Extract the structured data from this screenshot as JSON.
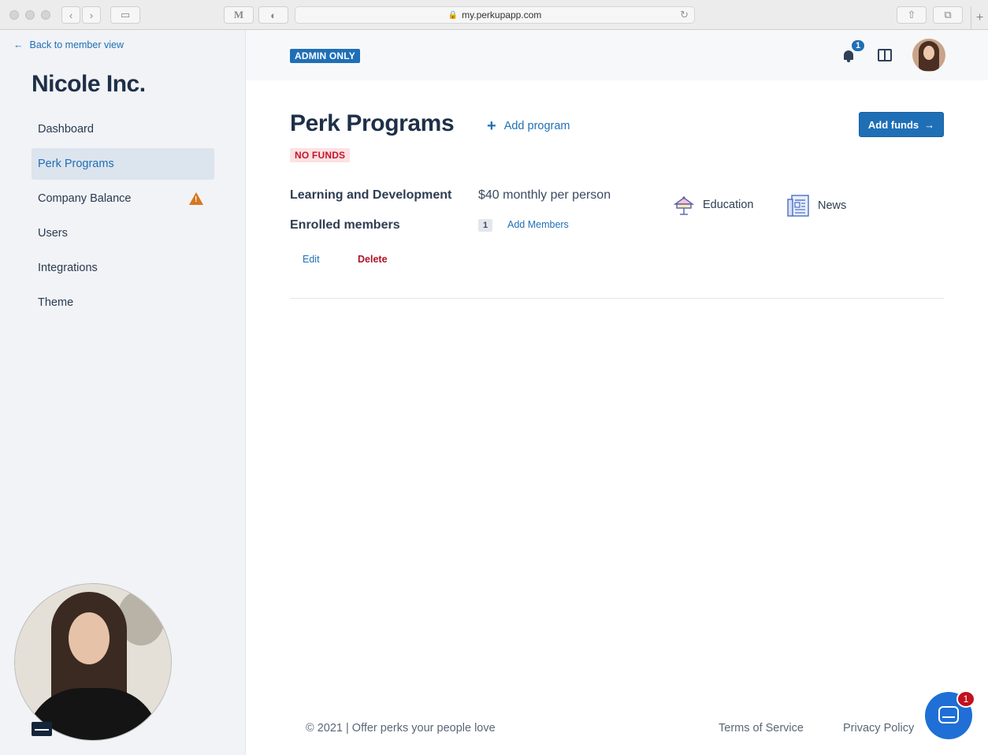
{
  "browser": {
    "url": "my.perkupapp.com"
  },
  "sidebar": {
    "back_link": "Back to member view",
    "company_name": "Nicole Inc.",
    "items": [
      {
        "label": "Dashboard",
        "active": false
      },
      {
        "label": "Perk Programs",
        "active": true
      },
      {
        "label": "Company Balance",
        "active": false,
        "warning": true
      },
      {
        "label": "Users",
        "active": false
      },
      {
        "label": "Integrations",
        "active": false
      },
      {
        "label": "Theme",
        "active": false
      }
    ]
  },
  "topbar": {
    "admin_badge": "ADMIN ONLY",
    "notification_count": "1"
  },
  "main": {
    "title": "Perk Programs",
    "add_program": "Add program",
    "add_funds": "Add funds",
    "status_badge": "NO FUNDS",
    "program": {
      "name": "Learning and Development",
      "amount": "$40 monthly per person",
      "enrolled_label": "Enrolled members",
      "enrolled_count": "1",
      "add_members": "Add Members",
      "categories": [
        {
          "label": "Education",
          "icon": "education-icon"
        },
        {
          "label": "News",
          "icon": "newspaper-icon"
        }
      ],
      "edit": "Edit",
      "delete": "Delete"
    }
  },
  "footer": {
    "copyright": "© 2021 | Offer perks your people love",
    "terms": "Terms of Service",
    "privacy": "Privacy Policy"
  },
  "chat": {
    "badge_count": "1"
  },
  "colors": {
    "accent": "#1f6fb6",
    "danger": "#c2162c",
    "warning": "#d6761e",
    "sidebar_bg": "#f1f3f6"
  }
}
